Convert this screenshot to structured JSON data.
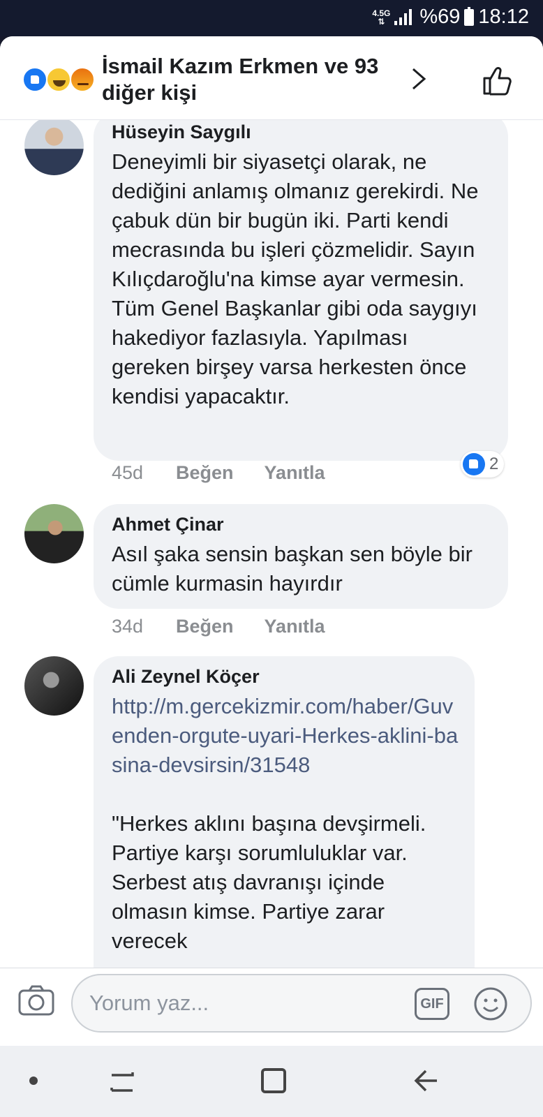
{
  "status_bar": {
    "network": "4.5G",
    "battery": "%69",
    "time": "18:12"
  },
  "header": {
    "reactors_text": "İsmail Kazım Erkmen ve 93 diğer kişi",
    "reaction_icons": [
      "like-icon",
      "haha-icon",
      "angry-icon"
    ]
  },
  "comments": [
    {
      "author": "Hüseyin Saygılı",
      "text": "Deneyimli bir siyasetçi olarak, ne dediğini anlamış olmanız gerekirdi. Ne çabuk dün bir bugün iki. Parti kendi mecrasında bu işleri çözmelidir. Sayın Kılıçdaroğlu'na kimse ayar vermesin. Tüm Genel Başkanlar gibi oda saygıyı hakediyor fazlasıyla. Yapılması gereken birşey varsa herkesten önce kendisi yapacaktır.",
      "time": "45d",
      "like_label": "Beğen",
      "reply_label": "Yanıtla",
      "reaction_count": "2"
    },
    {
      "author": "Ahmet Çinar",
      "text": "Asıl şaka sensin başkan sen böyle bir cümle kurmasin hayırdır",
      "time": "34d",
      "like_label": "Beğen",
      "reply_label": "Yanıtla"
    },
    {
      "author": "Ali Zeynel Köçer",
      "link": "http://m.gercekizmir.com/haber/Guvenden-orgute-uyari-Herkes-aklini-basina-devsirsin/31548",
      "text": "\"Herkes aklını başına devşirmeli. Partiye karşı sorumluluklar var. Serbest atış davranışı içinde olmasın kimse. Partiye zarar verecek"
    }
  ],
  "composer": {
    "placeholder": "Yorum yaz...",
    "gif_label": "GIF"
  },
  "colors": {
    "accent": "#1877f2",
    "bubble": "#f0f2f5",
    "link": "#4b5b7d",
    "status_bar": "#141a2e"
  }
}
